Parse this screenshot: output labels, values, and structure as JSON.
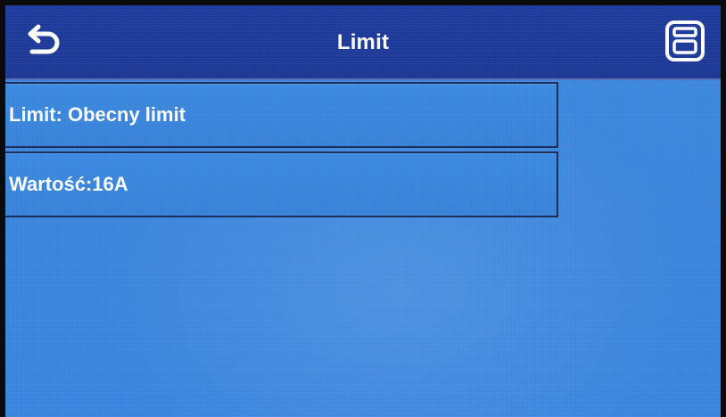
{
  "header": {
    "title": "Limit",
    "back_icon": "back-arrow-icon",
    "save_icon": "save-icon"
  },
  "menu": {
    "items": [
      {
        "label": "Limit: Obecny limit"
      },
      {
        "label": "Wartość:16A"
      }
    ]
  },
  "colors": {
    "header_bg": "#1f3c9e",
    "screen_bg": "#3b86de",
    "item_border": "#1a2b5c",
    "text": "#ffffff"
  }
}
